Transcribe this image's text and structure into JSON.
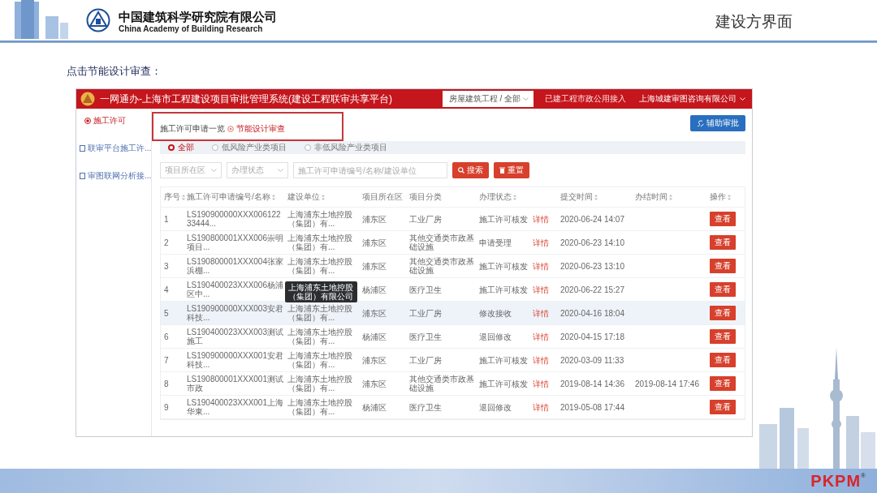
{
  "slide": {
    "organization_cn": "中国建筑科学研究院有限公司",
    "organization_en": "China Academy of Building Research",
    "title": "建设方界面",
    "instruction": "点击节能设计审查：",
    "footer_logo": "PKPM",
    "footer_logo_mark": "®"
  },
  "app": {
    "title": "一网通办-上海市工程建设项目审批管理系统(建设工程联审共享平台)",
    "project_select": "房屋建筑工程 / 全部",
    "header_link": "已建工程市政公用接入",
    "user": "上海城建审图咨询有限公司"
  },
  "sidebar": {
    "items": [
      {
        "label": "施工许可",
        "kind": "radio",
        "selected": true
      },
      {
        "label": "联审平台施工许...",
        "kind": "doc",
        "selected": false
      },
      {
        "label": "审图联网分析接...",
        "kind": "doc",
        "selected": false
      }
    ]
  },
  "breadcrumb": {
    "items": [
      "施工许可申请一览",
      "节能设计审查"
    ],
    "annotated": true
  },
  "assist_button": "辅助审批",
  "filter_tabs": [
    {
      "label": "全部",
      "selected": true
    },
    {
      "label": "低风险产业类项目",
      "selected": false
    },
    {
      "label": "非低风险产业类项目",
      "selected": false
    }
  ],
  "filters": {
    "district_placeholder": "项目所在区",
    "status_placeholder": "办理状态",
    "search_placeholder": "施工许可申请编号/名称/建设单位",
    "search_button": "搜索",
    "reset_button": "重置"
  },
  "table": {
    "columns": [
      {
        "label": "序号",
        "sortable": true
      },
      {
        "label": "施工许可申请编号/名称",
        "sortable": true
      },
      {
        "label": "建设单位",
        "sortable": true
      },
      {
        "label": "项目所在区",
        "sortable": false
      },
      {
        "label": "项目分类",
        "sortable": false
      },
      {
        "label": "办理状态",
        "sortable": true
      },
      {
        "label": "提交时间",
        "sortable": true
      },
      {
        "label": "办结时间",
        "sortable": true
      },
      {
        "label": "操作",
        "sortable": true
      }
    ],
    "rows": [
      {
        "index": "1",
        "code": "LS190900000XXX00612233444...",
        "company": "上海浦东土地控股（集团）有...",
        "district": "浦东区",
        "category": "工业厂房",
        "status": "施工许可核发",
        "detail": "详情",
        "submitted": "2020-06-24 14:07",
        "action": "查看",
        "highlighted": false
      },
      {
        "index": "2",
        "code": "LS190800001XXX006崇明项目...",
        "company": "上海浦东土地控股（集团）有...",
        "district": "浦东区",
        "category": "其他交通类市政基础设施",
        "status": "申请受理",
        "detail": "详情",
        "submitted": "2020-06-23 14:10",
        "action": "查看",
        "highlighted": false
      },
      {
        "index": "3",
        "code": "LS190800001XXX004张家浜棚...",
        "company": "上海浦东土地控股（集团）有...",
        "district": "浦东区",
        "category": "其他交通类市政基础设施",
        "status": "施工许可核发",
        "detail": "详情",
        "submitted": "2020-06-23 13:10",
        "action": "查看",
        "highlighted": false
      },
      {
        "index": "4",
        "code": "LS190400023XXX006杨浦区中...",
        "district": "杨浦区",
        "category": "医疗卫生",
        "status": "施工许可核发",
        "detail": "详情",
        "submitted": "2020-06-22 15:27",
        "action": "查看",
        "highlighted": false
      },
      {
        "index": "5",
        "code": "LS190900000XXX003安君科技...",
        "company": "上海浦东土地控股（集团）有...",
        "company_tooltip": "上海浦东土地控股（集团）有限公司",
        "district": "浦东区",
        "category": "工业厂房",
        "status": "修改接收",
        "detail": "详情",
        "submitted": "2020-04-16 18:04",
        "action": "查看",
        "highlighted": true
      },
      {
        "index": "6",
        "code": "LS190400023XXX003测试施工",
        "company": "上海浦东土地控股（集团）有...",
        "district": "杨浦区",
        "category": "医疗卫生",
        "status": "退回修改",
        "detail": "详情",
        "submitted": "2020-04-15 17:18",
        "action": "查看",
        "highlighted": false
      },
      {
        "index": "7",
        "code": "LS190900000XXX001安君科技...",
        "company": "上海浦东土地控股（集团）有...",
        "district": "浦东区",
        "category": "工业厂房",
        "status": "施工许可核发",
        "detail": "详情",
        "submitted": "2020-03-09 11:33",
        "action": "查看",
        "highlighted": false
      },
      {
        "index": "8",
        "code": "LS190800001XXX001测试市政",
        "company": "上海浦东土地控股（集团）有...",
        "district": "浦东区",
        "category": "其他交通类市政基础设施",
        "status": "施工许可核发",
        "detail": "详情",
        "submitted": "2019-08-14 14:36",
        "completed": "2019-08-14 17:46",
        "action": "查看",
        "highlighted": false
      },
      {
        "index": "9",
        "code": "LS190400023XXX001上海华東...",
        "company": "上海浦东土地控股（集团）有...",
        "district": "杨浦区",
        "category": "医疗卫生",
        "status": "退回修改",
        "detail": "详情",
        "submitted": "2019-05-08 17:44",
        "action": "查看",
        "highlighted": false
      }
    ]
  }
}
